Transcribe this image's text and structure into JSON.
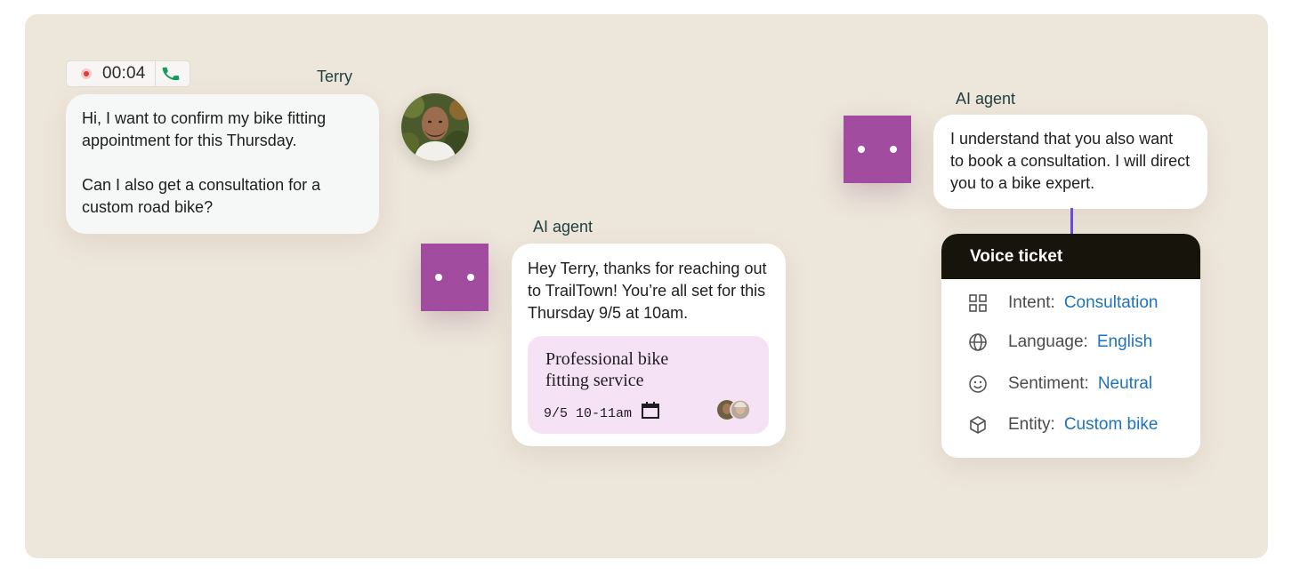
{
  "call": {
    "timer": "00:04"
  },
  "user_message": {
    "speaker": "Terry",
    "paragraph1": "Hi, I want to confirm my bike fitting appointment for this Thursday.",
    "paragraph2": "Can I also get a consultation for a custom road bike?"
  },
  "agent_reply_1": {
    "speaker": "AI agent",
    "text": "Hey Terry, thanks for reaching out to TrailTown! You’re all set for this Thursday 9/5 at 10am.",
    "event": {
      "title": "Professional bike fitting service",
      "time": "9/5 10-11am"
    }
  },
  "agent_reply_2": {
    "speaker": "AI agent",
    "text": "I understand that you also want to book a consultation. I will direct you to a bike expert."
  },
  "voice_ticket": {
    "title": "Voice ticket",
    "rows": [
      {
        "label": "Intent:",
        "value": "Consultation",
        "icon": "grid-icon"
      },
      {
        "label": "Language:",
        "value": "English",
        "icon": "globe-icon"
      },
      {
        "label": "Sentiment:",
        "value": "Neutral",
        "icon": "smiley-icon"
      },
      {
        "label": "Entity:",
        "value": "Custom bike",
        "icon": "cube-icon"
      }
    ]
  },
  "colors": {
    "background": "#ede6da",
    "agent_face": "#a24c9f",
    "event_card": "#f6e2f5",
    "ticket_header": "#17140c",
    "ticket_value": "#1f73b7",
    "connector": "#6a4be0",
    "record": "#e03a3a",
    "phone": "#0f9d58"
  }
}
